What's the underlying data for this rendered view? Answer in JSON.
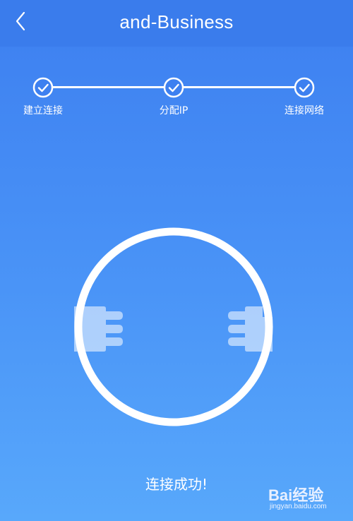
{
  "header": {
    "title": "and-Business",
    "back_icon": "chevron-left-icon"
  },
  "steps": [
    {
      "label": "建立连接",
      "done": true
    },
    {
      "label": "分配IP",
      "done": true
    },
    {
      "label": "连接网络",
      "done": true
    }
  ],
  "status": {
    "message": "连接成功!"
  },
  "watermark": {
    "brand": "Bai经验",
    "url": "jingyan.baidu.com"
  },
  "colors": {
    "accent": "#3d7ff0",
    "line": "#ffffff"
  }
}
